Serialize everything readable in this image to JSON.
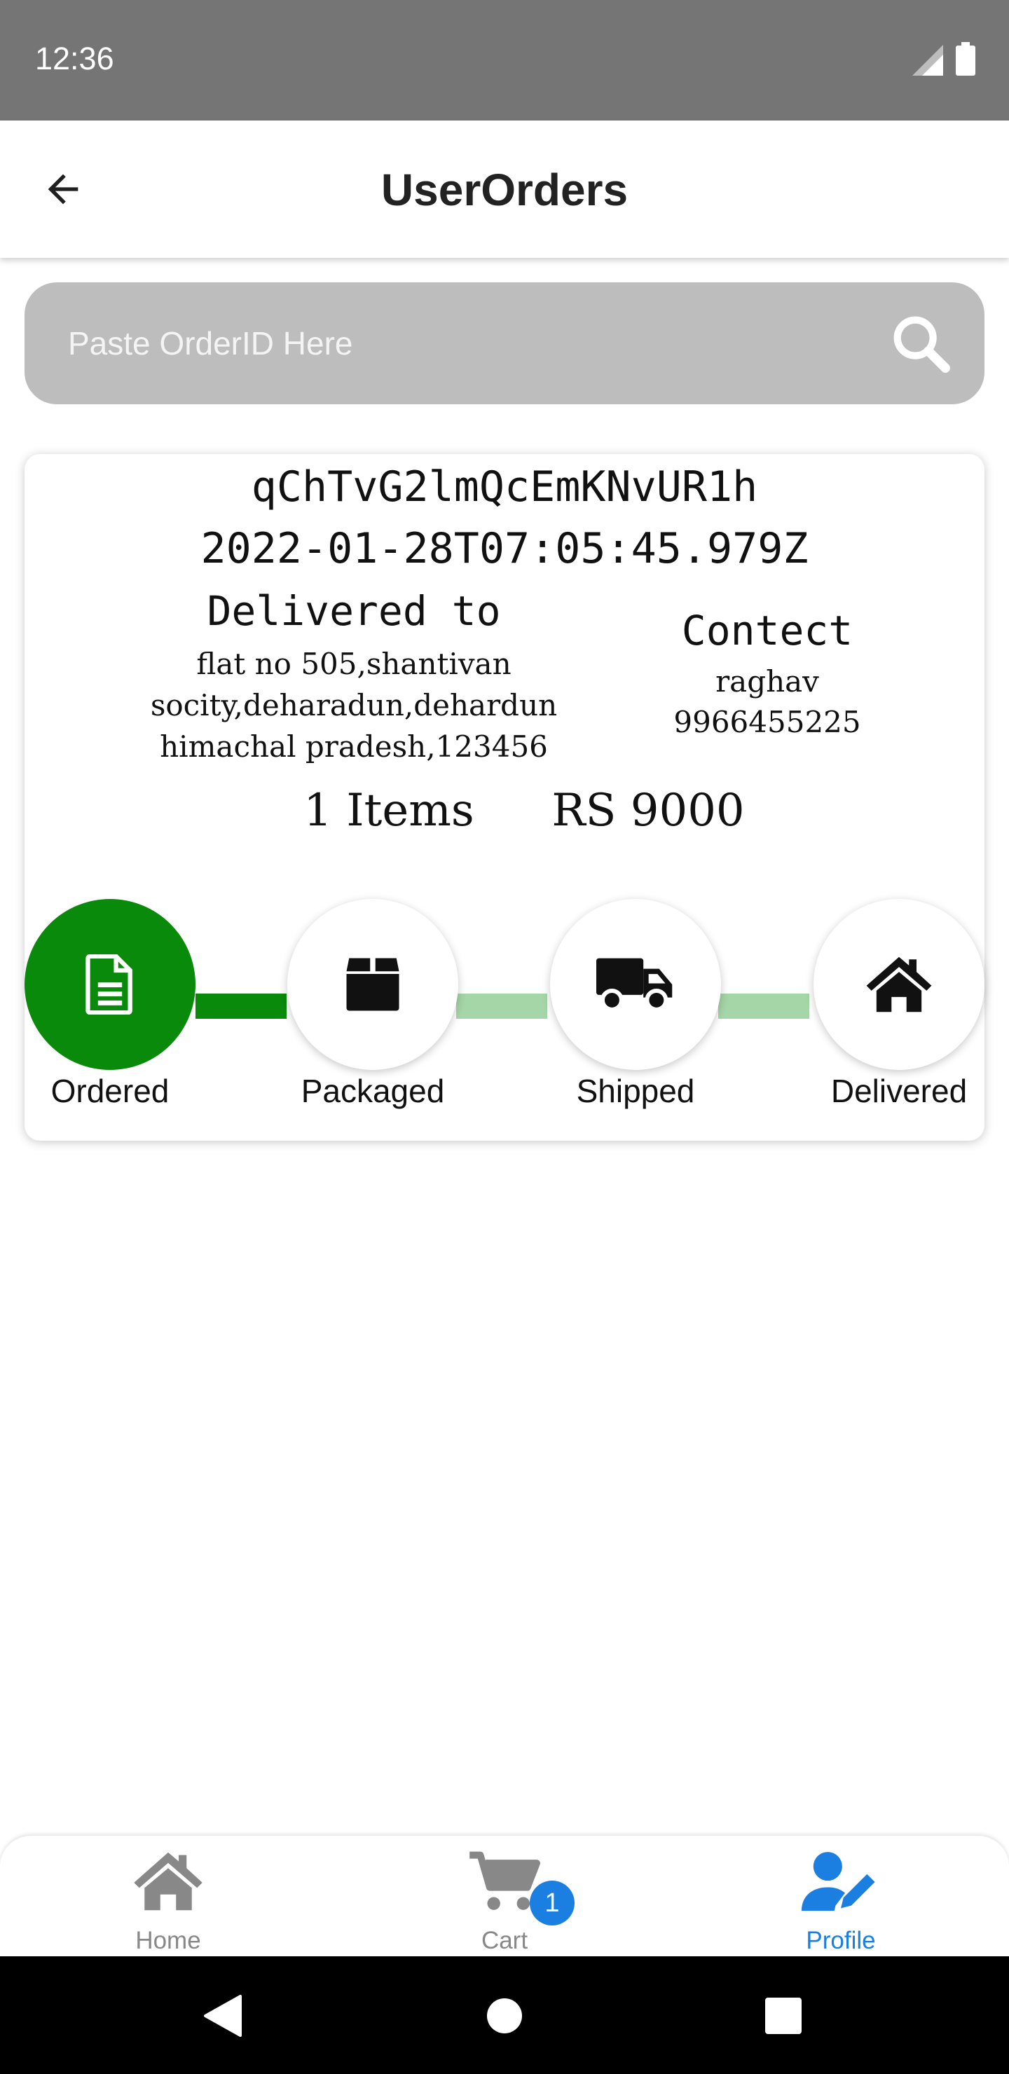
{
  "status_bar": {
    "time": "12:36"
  },
  "app_bar": {
    "title": "UserOrders"
  },
  "search": {
    "placeholder": "Paste OrderID Here",
    "value": ""
  },
  "order": {
    "id": "qChTvG2lmQcEmKNvUR1h",
    "date": "2022-01-28T07:05:45.979Z",
    "delivered_heading": "Delivered to",
    "address_line1": "flat no 505,shantivan",
    "address_line2": "socity,deharadun,dehardun",
    "address_line3": "himachal pradesh,123456",
    "contact_heading": "Contect",
    "contact_name": "raghav",
    "contact_phone": "9966455225",
    "items": "1 Items",
    "price": "RS 9000",
    "current_step": 1,
    "steps": [
      {
        "label": "Ordered",
        "icon": "file-icon"
      },
      {
        "label": "Packaged",
        "icon": "box-icon"
      },
      {
        "label": "Shipped",
        "icon": "truck-icon"
      },
      {
        "label": "Delivered",
        "icon": "home-icon"
      }
    ]
  },
  "bottom_nav": {
    "items": [
      {
        "label": "Home",
        "icon": "home-icon"
      },
      {
        "label": "Cart",
        "icon": "cart-icon",
        "badge": "1"
      },
      {
        "label": "Profile",
        "icon": "user-edit-icon",
        "active": true
      }
    ]
  },
  "colors": {
    "accent_green": "#0a8a0a",
    "light_green": "#a5d6a7",
    "accent_blue": "#1a7fe0",
    "search_bg": "#bdbdbd",
    "status_bar_bg": "#757575"
  }
}
